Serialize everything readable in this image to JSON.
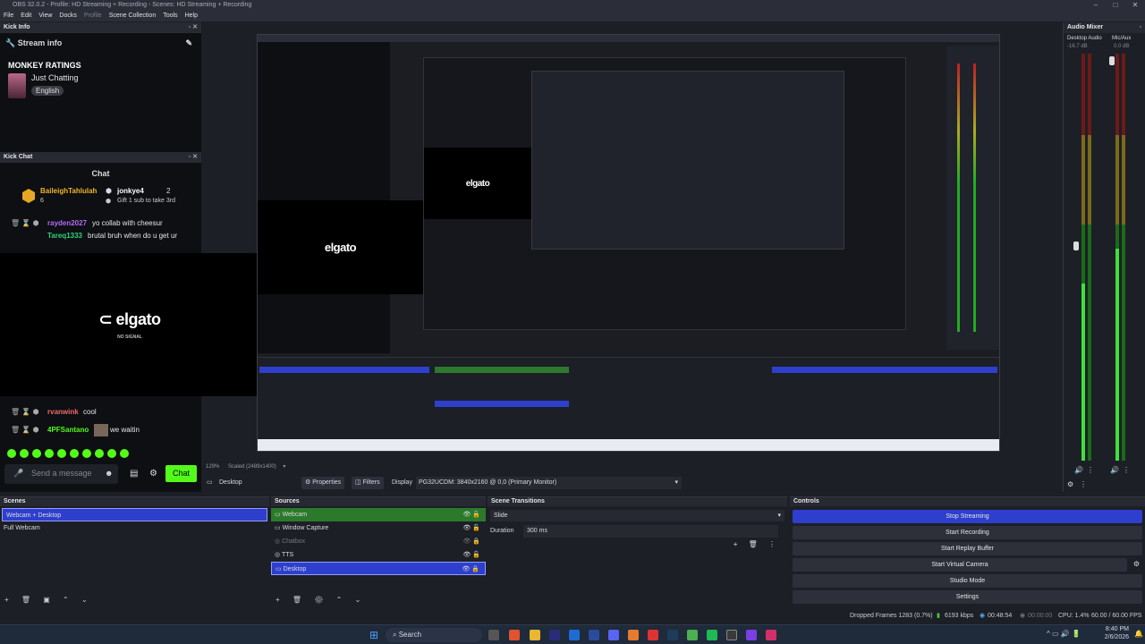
{
  "window": {
    "title": "OBS 32.0.2 - Profile: HD Streaming + Recording - Scenes: HD Streaming + Recording"
  },
  "menu": {
    "items": [
      "File",
      "Edit",
      "View",
      "Docks",
      "Profile",
      "Scene Collection",
      "Tools",
      "Help"
    ]
  },
  "stream_info": {
    "dock_title": "Kick Info",
    "heading": "Stream info",
    "channel": "MONKEY RATINGS",
    "category": "Just Chatting",
    "language": "English"
  },
  "chat": {
    "dock_title": "Kick Chat",
    "heading": "Chat",
    "gift": {
      "user": "BaileighTahlulah",
      "count": "6",
      "recipient": "jonkye4",
      "recipient_count": "2",
      "text": "Gift 1 sub to take 3rd"
    },
    "messages": [
      {
        "user": "rayden2027",
        "text": "yo collab with cheesur"
      },
      {
        "user": "Tareq1333",
        "text": "brutal bruh when do u get ur"
      },
      {
        "user": "rvanwink",
        "text": "cool"
      },
      {
        "user": "4PFSantano",
        "text": "we waitin"
      }
    ],
    "placeholder": "Send a message",
    "send": "Chat"
  },
  "elgato": {
    "logo": "elgato",
    "sub": "NO SIGNAL"
  },
  "preview_bar": {
    "zoom": "129%",
    "scale": "Scaled (2489x1400)"
  },
  "source_toolbar": {
    "source": "Desktop",
    "properties": "Properties",
    "filters": "Filters",
    "display_label": "Display",
    "display_value": "PG32UCDM: 3840x2160 @ 0,0 (Primary Monitor)"
  },
  "scenes": {
    "title": "Scenes",
    "items": [
      "Webcam + Desktop",
      "Full Webcam"
    ],
    "selected": 0
  },
  "sources": {
    "title": "Sources",
    "items": [
      {
        "name": "Webcam",
        "state": "green"
      },
      {
        "name": "Window Capture",
        "state": "normal"
      },
      {
        "name": "Chatbox",
        "state": "dim"
      },
      {
        "name": "TTS",
        "state": "normal"
      },
      {
        "name": "Desktop",
        "state": "blue"
      }
    ]
  },
  "transitions": {
    "title": "Scene Transitions",
    "type": "Slide",
    "duration_label": "Duration",
    "duration_value": "300 ms"
  },
  "controls": {
    "title": "Controls",
    "buttons": [
      "Stop Streaming",
      "Start Recording",
      "Start Replay Buffer",
      "Start Virtual Camera",
      "Studio Mode",
      "Settings"
    ]
  },
  "mixer": {
    "title": "Audio Mixer",
    "ch1": "Desktop Audio",
    "ch1_db": "-16.7 dB",
    "ch2": "Mic/Aux",
    "ch2_db": "0.0 dB",
    "ch1_level": 0.75,
    "ch2_level": 0.9
  },
  "status": {
    "dropped": "Dropped Frames 1283 (0.7%)",
    "bitrate": "6193 kbps",
    "stream_time": "00:48:54",
    "rec_time": "00:00:00",
    "cpu": "CPU: 1.4%",
    "fps": "60.00 / 60.00 FPS"
  },
  "taskbar": {
    "search": "Search",
    "time": "8:40 PM",
    "date": "2/6/2026"
  },
  "colors": {
    "kick_green": "#53fc18",
    "selected_blue": "#2e3fce",
    "source_green": "#2b7a2b"
  }
}
